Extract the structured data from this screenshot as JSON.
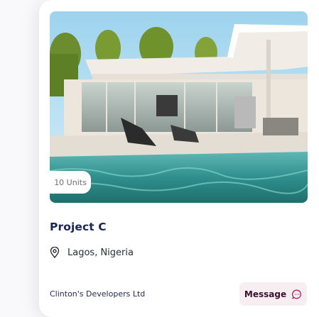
{
  "listing": {
    "units_badge": "10 Units",
    "title": "Project C",
    "location": "Lagos, Nigeria",
    "developer": "Clinton's Developers Ltd",
    "message_label": "Message",
    "icons": {
      "location": "map-pin-icon",
      "message": "chat-bubble-icon"
    }
  },
  "colors": {
    "title": "#1c2451",
    "message_button_bg": "#f7eef1",
    "message_button_text": "#3b1230",
    "message_icon": "#c2185b"
  }
}
